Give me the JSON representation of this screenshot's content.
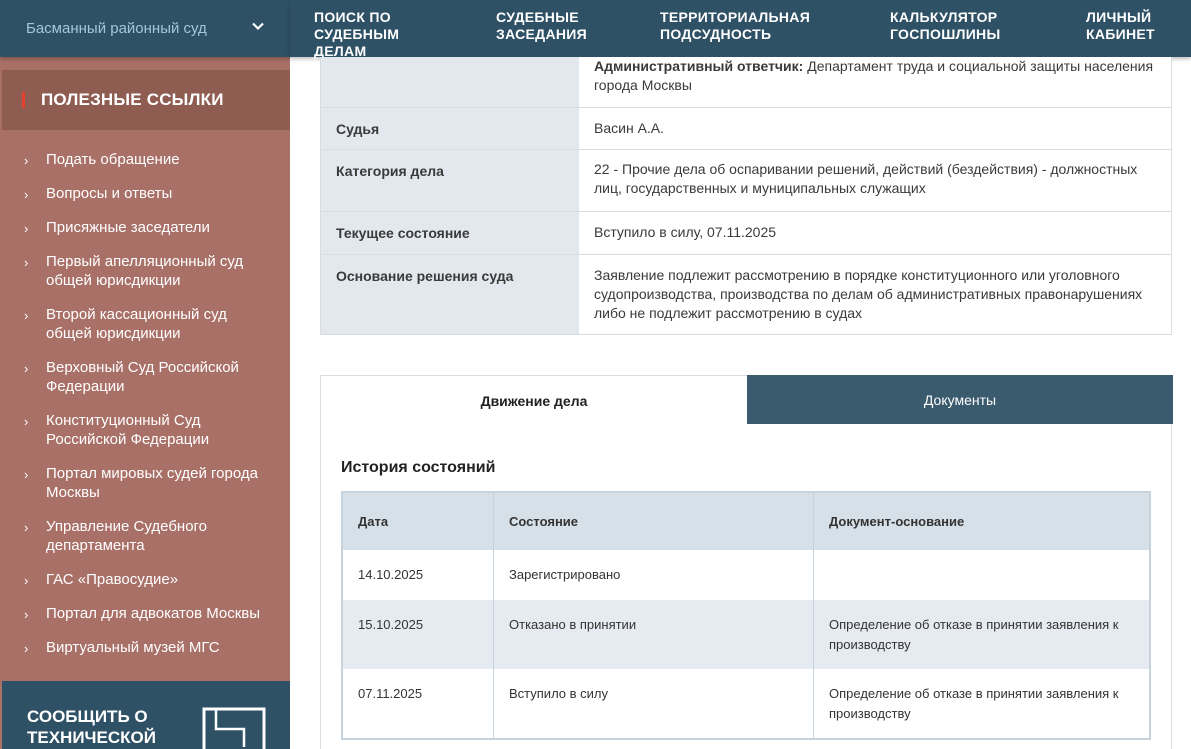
{
  "sidebar": {
    "court_name": "Басманный районный суд",
    "links_title": "ПОЛЕЗНЫЕ ССЫЛКИ",
    "links": [
      "Подать обращение",
      "Вопросы и ответы",
      "Присяжные заседатели",
      "Первый апелляционный суд общей юрисдикции",
      "Второй кассационный суд общей юрисдикции",
      "Верховный Суд Российской Федерации",
      "Конституционный Суд Российской Федерации",
      "Портал мировых судей города Москвы",
      "Управление Судебного департамента",
      "ГАС «Правосудие»",
      "Портал для адвокатов Москвы",
      "Виртуальный музей МГС"
    ],
    "report_label": "СООБЩИТЬ О ТЕХНИЧЕСКОЙ"
  },
  "nav": {
    "items": [
      "ПОИСК ПО СУДЕБНЫМ ДЕЛАМ",
      "СУДЕБНЫЕ ЗАСЕДАНИЯ",
      "ТЕРРИТОРИАЛЬНАЯ ПОДСУДНОСТЬ",
      "КАЛЬКУЛЯТОР ГОСПОШЛИНЫ",
      "ЛИЧНЫЙ КАБИНЕТ"
    ]
  },
  "case_info": {
    "respondent_label": "Административный ответчик:",
    "respondent_value": "Департамент труда и социальной защиты населения города Москвы",
    "rows": [
      {
        "key": "Судья",
        "value": "Васин А.А."
      },
      {
        "key": "Категория дела",
        "value": "22 - Прочие дела об оспаривании решений, действий (бездействия) - должностных лиц, государственных и муниципальных служащих"
      },
      {
        "key": "Текущее состояние",
        "value": "Вступило в силу, 07.11.2025"
      },
      {
        "key": "Основание решения суда",
        "value": "Заявление подлежит рассмотрению в порядке конституционного или уголовного судопроизводства, производства по делам об административных правонарушениях либо не подлежит рассмотрению в судах"
      }
    ]
  },
  "tabs": {
    "active": "Движение дела",
    "inactive": "Документы"
  },
  "history": {
    "title": "История состояний",
    "headers": [
      "Дата",
      "Состояние",
      "Документ-основание"
    ],
    "rows": [
      {
        "date": "14.10.2025",
        "state": "Зарегистрировано",
        "doc": ""
      },
      {
        "date": "15.10.2025",
        "state": "Отказано в принятии",
        "doc": "Определение об отказе в принятии заявления к производству"
      },
      {
        "date": "07.11.2025",
        "state": "Вступило в силу",
        "doc": "Определение об отказе в принятии заявления к производству"
      }
    ]
  },
  "colors": {
    "nav_bg": "#2f5166",
    "sidebar_bg": "#a97068",
    "links_header_bg": "#8e5c51",
    "accent_bar": "#e4422e",
    "tab_inactive_bg": "#3a5a6e"
  }
}
